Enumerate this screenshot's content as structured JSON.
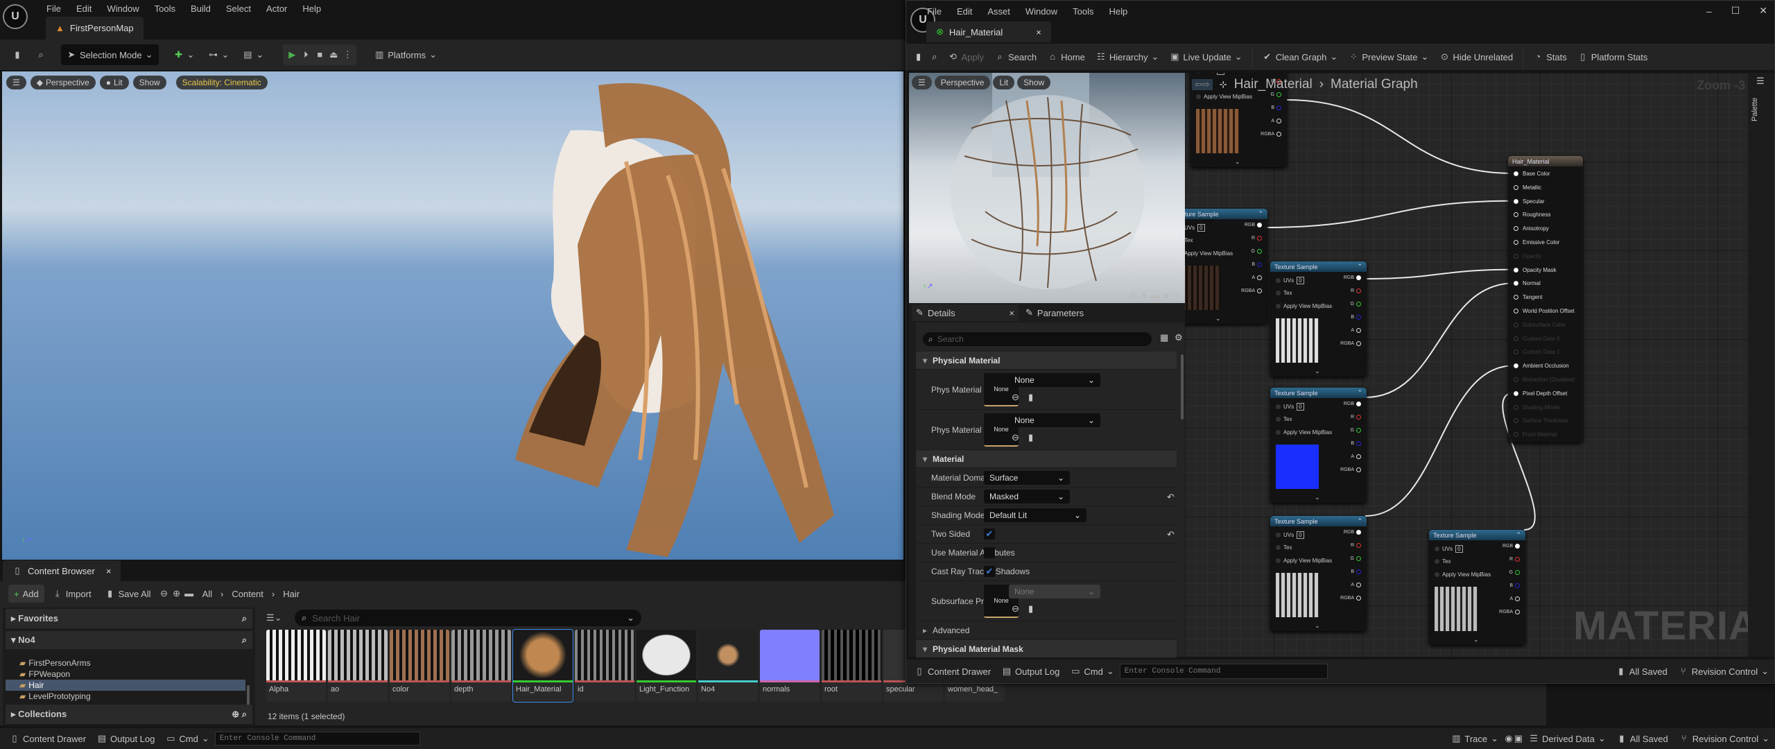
{
  "main": {
    "menu": [
      "File",
      "Edit",
      "Window",
      "Tools",
      "Build",
      "Select",
      "Actor",
      "Help"
    ],
    "tab": "FirstPersonMap",
    "toolbar": {
      "selection_mode": "Selection Mode",
      "platforms": "Platforms"
    },
    "viewport": {
      "perspective": "Perspective",
      "lit": "Lit",
      "show": "Show",
      "scalability": "Scalability: Cinematic"
    },
    "content_browser": {
      "tab": "Content Browser",
      "add": "Add",
      "import": "Import",
      "save_all": "Save All",
      "breadcrumb": [
        "All",
        "Content",
        "Hair"
      ],
      "favorites": "Favorites",
      "root": "No4",
      "folders": [
        "FirstPersonArms",
        "FPWeapon",
        "Hair",
        "LevelPrototyping"
      ],
      "selected_folder": "Hair",
      "collections": "Collections",
      "search_placeholder": "Search Hair",
      "assets": [
        "Alpha",
        "ao",
        "color",
        "depth",
        "Hair_Material",
        "id",
        "Light_Function",
        "No4",
        "normals",
        "root",
        "specular",
        "women_head_"
      ],
      "selected_asset": "Hair_Material",
      "status": "12 items (1 selected)"
    },
    "statusbar": {
      "content_drawer": "Content Drawer",
      "output_log": "Output Log",
      "cmd": "Cmd",
      "console_placeholder": "Enter Console Command",
      "trace": "Trace",
      "derived_data": "Derived Data",
      "all_saved": "All Saved",
      "revision_control": "Revision Control"
    }
  },
  "editor": {
    "menu": [
      "File",
      "Edit",
      "Asset",
      "Window",
      "Tools",
      "Help"
    ],
    "tab": "Hair_Material",
    "toolbar": [
      "Apply",
      "Search",
      "Home",
      "Hierarchy",
      "Live Update",
      "Clean Graph",
      "Preview State",
      "Hide Unrelated",
      "Stats",
      "Platform Stats"
    ],
    "preview": {
      "perspective": "Perspective",
      "lit": "Lit",
      "show": "Show"
    },
    "details": {
      "tab": "Details",
      "tab2": "Parameters",
      "search_placeholder": "Search",
      "sections": {
        "physical_material": "Physical Material",
        "material": "Material",
        "advanced": "Advanced",
        "physical_material_mask": "Physical Material Mask"
      },
      "none": "None",
      "phys_material": {
        "label": "Phys Material",
        "value": "None"
      },
      "phys_material_mask": {
        "label": "Phys Material Mask",
        "value": "None"
      },
      "material_domain": {
        "label": "Material Domain",
        "value": "Surface"
      },
      "blend_mode": {
        "label": "Blend Mode",
        "value": "Masked"
      },
      "shading_model": {
        "label": "Shading Model",
        "value": "Default Lit"
      },
      "two_sided": {
        "label": "Two Sided",
        "checked": true
      },
      "use_material_attributes": {
        "label": "Use Material Attributes",
        "checked": false
      },
      "cast_ray_traced_shadows": {
        "label": "Cast Ray Traced Shadows",
        "checked": true
      },
      "subsurface_profile": {
        "label": "Subsurface Profile",
        "value": "None"
      }
    },
    "graph": {
      "breadcrumb": [
        "Hair_Material",
        "Material Graph"
      ],
      "zoom": "Zoom -3",
      "palette": "Palette",
      "watermark": "MATERIAL",
      "node_title": "Texture Sample",
      "inputs": [
        "UVs",
        "Tex",
        "Apply View MipBias"
      ],
      "uv_value": "0",
      "outputs": [
        "RGB",
        "R",
        "G",
        "B",
        "A",
        "RGBA"
      ],
      "result_title": "Hair_Material",
      "result_pins": [
        {
          "label": "Base Color",
          "on": true,
          "linked": true
        },
        {
          "label": "Metallic",
          "on": true
        },
        {
          "label": "Specular",
          "on": true,
          "linked": true
        },
        {
          "label": "Roughness",
          "on": true
        },
        {
          "label": "Anisotropy",
          "on": true
        },
        {
          "label": "Emissive Color",
          "on": true
        },
        {
          "label": "Opacity",
          "on": false
        },
        {
          "label": "Opacity Mask",
          "on": true,
          "linked": true
        },
        {
          "label": "Normal",
          "on": true,
          "linked": true
        },
        {
          "label": "Tangent",
          "on": true
        },
        {
          "label": "World Position Offset",
          "on": true
        },
        {
          "label": "Subsurface Color",
          "on": false
        },
        {
          "label": "Custom Data 0",
          "on": false
        },
        {
          "label": "Custom Data 1",
          "on": false
        },
        {
          "label": "Ambient Occlusion",
          "on": true,
          "linked": true
        },
        {
          "label": "Refraction (Disabled)",
          "on": false
        },
        {
          "label": "Pixel Depth Offset",
          "on": true,
          "linked": true
        },
        {
          "label": "Shading Model",
          "on": false
        },
        {
          "label": "Surface Thickness",
          "on": false
        },
        {
          "label": "Front Material",
          "on": false
        }
      ]
    },
    "statusbar": {
      "content_drawer": "Content Drawer",
      "output_log": "Output Log",
      "cmd": "Cmd",
      "console_placeholder": "Enter Console Command",
      "all_saved": "All Saved",
      "revision_control": "Revision Control"
    }
  }
}
